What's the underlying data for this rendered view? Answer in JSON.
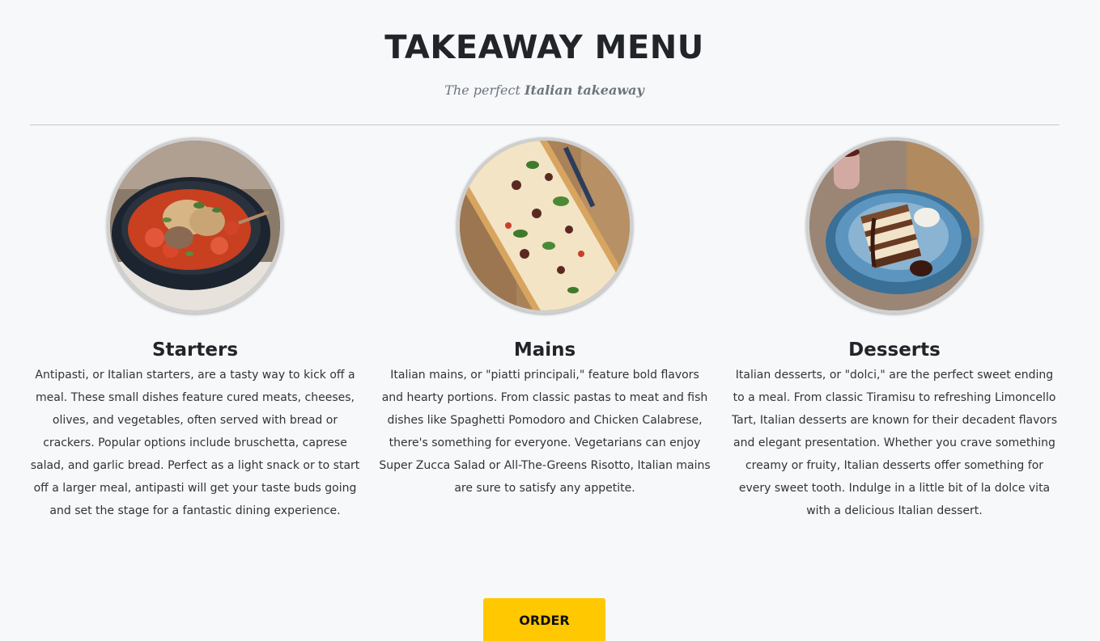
{
  "header": {
    "title": "TAKEAWAY MENU",
    "subtitle_prefix": "The perfect ",
    "subtitle_emphasis": "Italian takeaway"
  },
  "sections": [
    {
      "title": "Starters",
      "image": "gnocchi-bowl-image",
      "description": "Antipasti, or Italian starters, are a tasty way to kick off a meal. These small dishes feature cured meats, cheeses, olives, and vegetables, often served with bread or crackers. Popular options include bruschetta, caprese salad, and garlic bread. Perfect as a light snack or to start off a larger meal, antipasti will get your taste buds going and set the stage for a fantastic dining experience."
    },
    {
      "title": "Mains",
      "image": "flatbread-pizza-image",
      "description": "Italian mains, or \"piatti principali,\" feature bold flavors and hearty portions. From classic pastas to meat and fish dishes like Spaghetti Pomodoro and Chicken Calabrese, there's something for everyone. Vegetarians can enjoy Super Zucca Salad or All-The-Greens Risotto, Italian mains are sure to satisfy any appetite."
    },
    {
      "title": "Desserts",
      "image": "tiramisu-image",
      "description": "Italian desserts, or \"dolci,\" are the perfect sweet ending to a meal. From classic Tiramisu to refreshing Limoncello Tart, Italian desserts are known for their decadent flavors and elegant presentation. Whether you crave something creamy or fruity, Italian desserts offer something for every sweet tooth. Indulge in a little bit of la dolce vita with a delicious Italian dessert."
    }
  ],
  "cta": {
    "label": "ORDER",
    "color": "#ffc800"
  },
  "colors": {
    "background": "#f7f8fa",
    "heading": "#212529",
    "subtitle": "#6c757d"
  }
}
